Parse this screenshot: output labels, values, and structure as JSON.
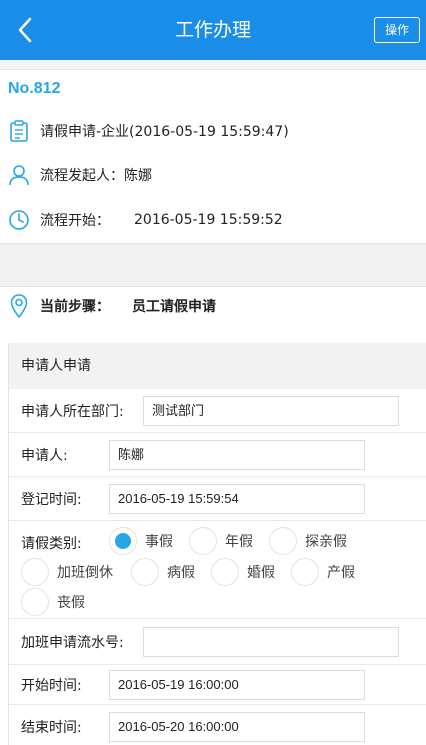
{
  "header": {
    "title": "工作办理",
    "action_label": "操作"
  },
  "record": {
    "number": "No.812"
  },
  "info": {
    "request_title": "请假申请-企业(2016-05-19 15:59:47)",
    "initiator_label": "流程发起人：",
    "initiator_value": "陈娜",
    "start_label": "流程开始：",
    "start_value": "2016-05-19 15:59:52"
  },
  "step": {
    "label": "当前步骤：",
    "value": "员工请假申请"
  },
  "form": {
    "section_title": "申请人申请",
    "department_label": "申请人所在部门:",
    "department_value": "测试部门",
    "applicant_label": "申请人:",
    "applicant_value": "陈娜",
    "register_time_label": "登记时间:",
    "register_time_value": "2016-05-19 15:59:54",
    "leave_type_label": "请假类别:",
    "leave_types": [
      {
        "label": "事假",
        "selected": true
      },
      {
        "label": "年假",
        "selected": false
      },
      {
        "label": "探亲假",
        "selected": false
      },
      {
        "label": "加班倒休",
        "selected": false
      },
      {
        "label": "病假",
        "selected": false
      },
      {
        "label": "婚假",
        "selected": false
      },
      {
        "label": "产假",
        "selected": false
      },
      {
        "label": "丧假",
        "selected": false
      }
    ],
    "overtime_no_label": "加班申请流水号:",
    "overtime_no_value": "",
    "start_time_label": "开始时间:",
    "start_time_value": "2016-05-19 16:00:00",
    "end_time_label": "结束时间:",
    "end_time_value": "2016-05-20 16:00:00"
  },
  "colors": {
    "primary": "#1a8de9",
    "accent": "#27a6e6"
  },
  "icons": [
    "back-arrow-icon",
    "document-icon",
    "user-icon",
    "clock-icon",
    "location-pin-icon"
  ]
}
